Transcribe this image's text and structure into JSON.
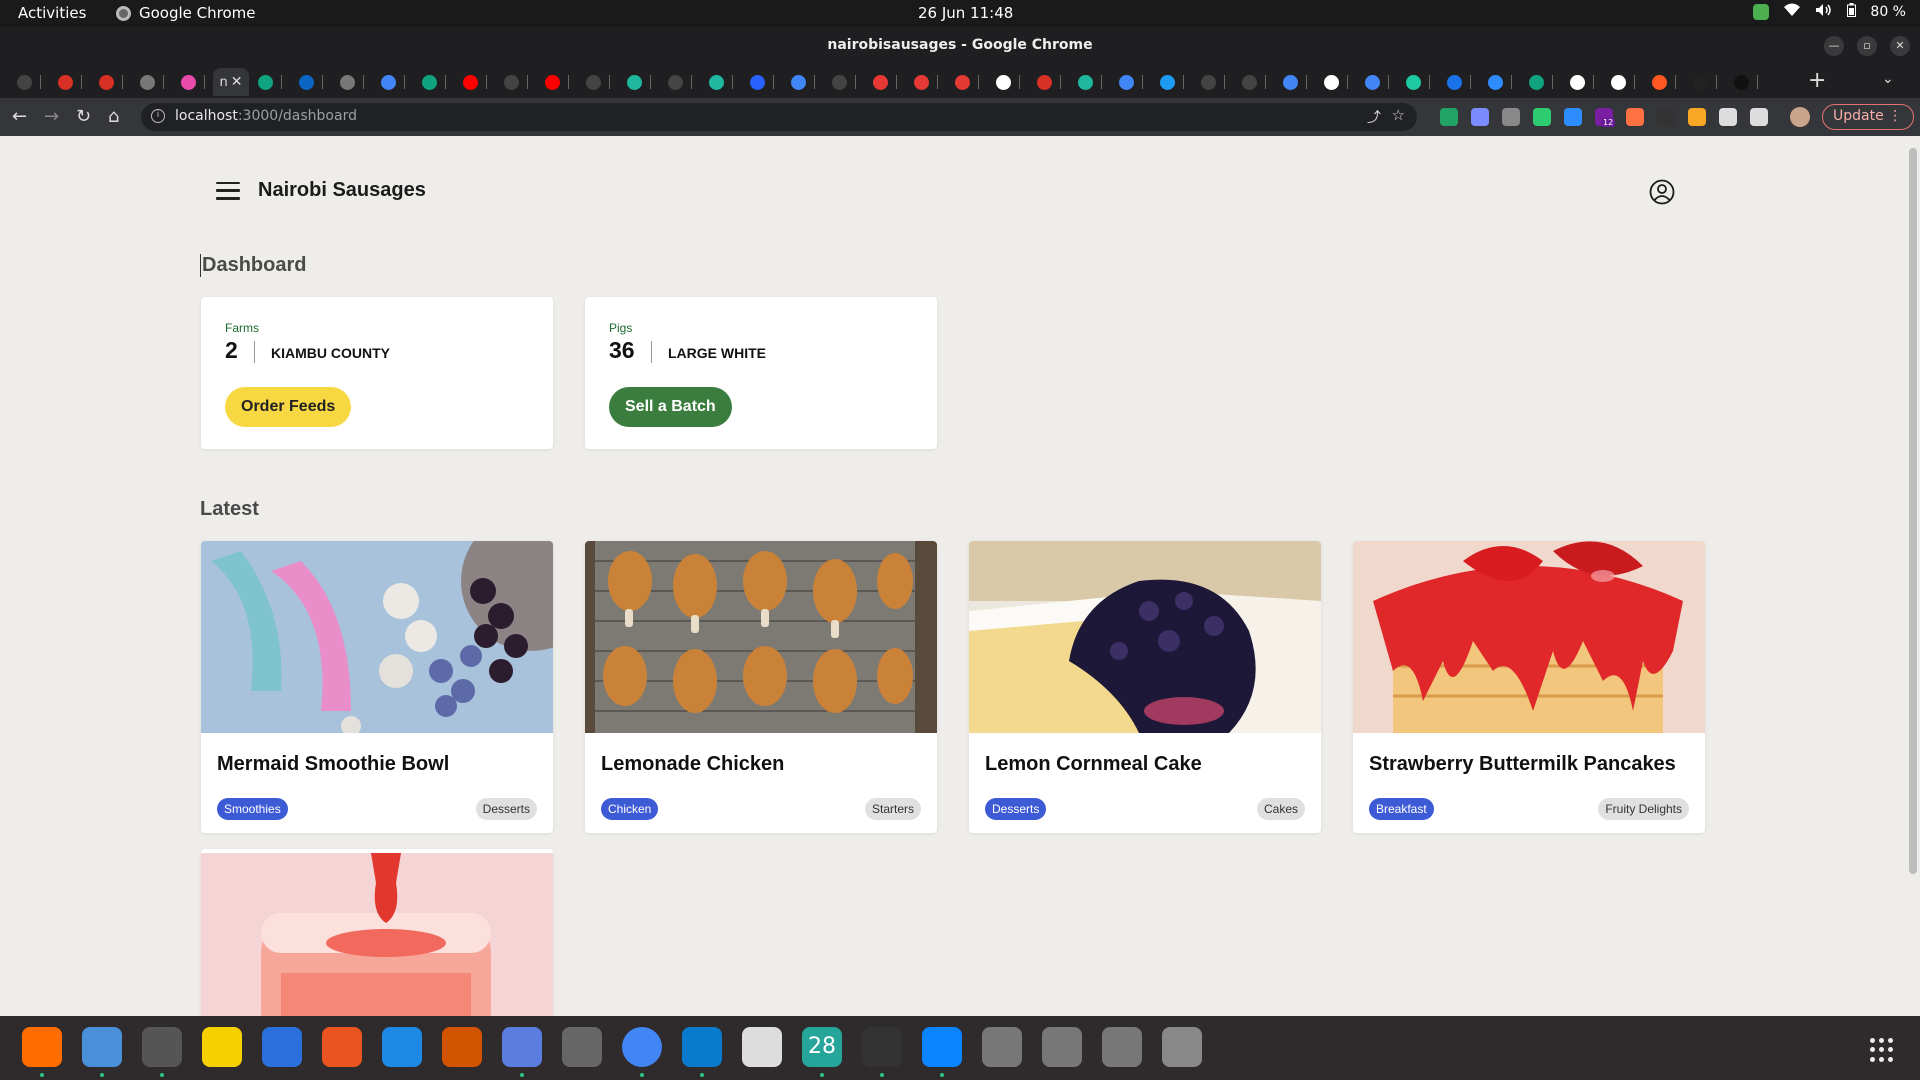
{
  "system_bar": {
    "activities": "Activities",
    "app_name": "Google Chrome",
    "clock": "26 Jun  11:48",
    "battery": "80 %"
  },
  "window": {
    "title": "nairobisausages - Google Chrome"
  },
  "browser": {
    "active_tab_label": "n",
    "url_host": "localhost",
    "url_path": ":3000/dashboard",
    "extension_badge": "12",
    "update_label": "Update",
    "tab_favicon_colors": [
      "#444",
      "#d93025",
      "#d93025",
      "#777",
      "#ea4aaa",
      "#fff",
      "#10a37f",
      "#0a66c2",
      "#777",
      "#4285f4",
      "#10a37f",
      "#ff0000",
      "#444",
      "#ff0000",
      "#444",
      "#1fb79f",
      "#444",
      "#1fb79f",
      "#2962ff",
      "#4285f4",
      "#444",
      "#e53935",
      "#e53935",
      "#e53935",
      "#fff",
      "#d93025",
      "#1fb79f",
      "#4285f4",
      "#1d9bf0",
      "#444",
      "#444",
      "#4285f4",
      "#fff",
      "#4285f4",
      "#1ec8a0",
      "#1a73e8",
      "#2d8cff",
      "#10a37f",
      "#fff",
      "#fff",
      "#ff5722",
      "#222",
      "#111"
    ],
    "extension_colors": [
      "#21a366",
      "#7c8cff",
      "#888",
      "#2ecc71",
      "#2d8cff",
      "#7b1fa2",
      "#ff7043",
      "#333",
      "#f9a825",
      "#ddd",
      "#ddd"
    ]
  },
  "app": {
    "brand": "Nairobi Sausages",
    "dashboard_title": "Dashboard",
    "cards": [
      {
        "label": "Farms",
        "value": "2",
        "desc": "KIAMBU COUNTY",
        "button": "Order Feeds"
      },
      {
        "label": "Pigs",
        "value": "36",
        "desc": "LARGE WHITE",
        "button": "Sell a Batch"
      }
    ],
    "latest_title": "Latest",
    "recipes": [
      {
        "title": "Mermaid Smoothie Bowl",
        "tag1": "Smoothies",
        "tag2": "Desserts"
      },
      {
        "title": "Lemonade Chicken",
        "tag1": "Chicken",
        "tag2": "Starters"
      },
      {
        "title": "Lemon Cornmeal Cake",
        "tag1": "Desserts",
        "tag2": "Cakes"
      },
      {
        "title": "Strawberry Buttermilk Pancakes",
        "tag1": "Breakfast",
        "tag2": "Fruity Delights"
      }
    ]
  },
  "dock": {
    "calendar_day": "28",
    "icon_colors": [
      "#ff6d00",
      "#4a90d9",
      "#555",
      "#f7d000",
      "#2a6fdb",
      "#e95420",
      "#1e88e5",
      "#d35400",
      "#5b7de0",
      "#666",
      "#4285f4",
      "#0a7acc",
      "#ddd",
      "#26a69a",
      "#333",
      "#0a84ff",
      "#777",
      "#777",
      "#777",
      "#888"
    ]
  }
}
